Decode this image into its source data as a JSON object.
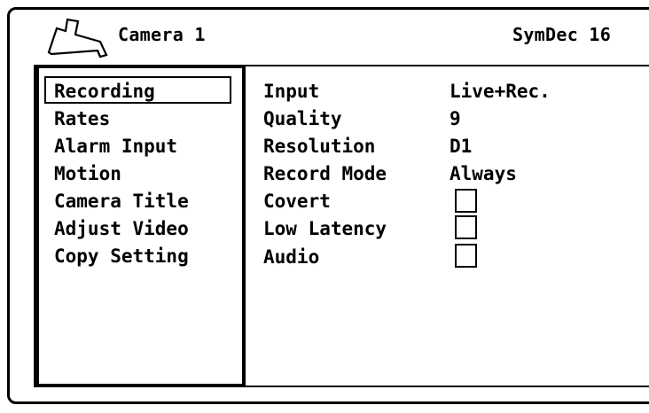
{
  "header": {
    "camera_title": "Camera 1",
    "brand": "SymDec 16",
    "icon": "camera-icon"
  },
  "menu": {
    "selected": "Recording",
    "items": [
      {
        "label": "Recording"
      },
      {
        "label": "Rates"
      },
      {
        "label": "Alarm Input"
      },
      {
        "label": "Motion"
      },
      {
        "label": "Camera Title"
      },
      {
        "label": "Adjust Video"
      },
      {
        "label": "Copy Setting"
      }
    ]
  },
  "settings": [
    {
      "label": "Input",
      "value": "Live+Rec."
    },
    {
      "label": "Quality",
      "value": "9"
    },
    {
      "label": "Resolution",
      "value": "D1"
    },
    {
      "label": "Record Mode",
      "value": "Always"
    },
    {
      "label": "Covert",
      "checked": false
    },
    {
      "label": "Low Latency",
      "checked": false
    },
    {
      "label": "Audio",
      "checked": false
    }
  ],
  "colors": {
    "foreground": "#000000",
    "background": "#ffffff"
  }
}
